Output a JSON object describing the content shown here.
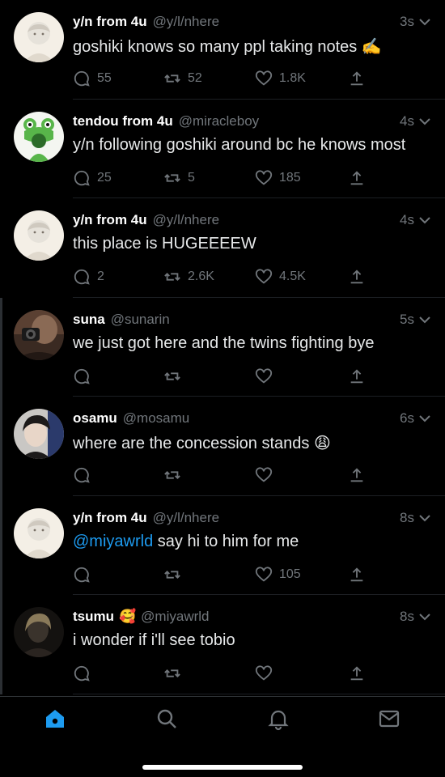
{
  "tweets": [
    {
      "name": "y/n from 4u",
      "emoji": "",
      "handle": "@y/l/nhere",
      "time": "3s",
      "text": "goshiki knows so many ppl taking notes ✍️",
      "mention": "",
      "replies": "55",
      "retweets": "52",
      "likes": "1.8K",
      "avatar": "pale-avatar-icon"
    },
    {
      "name": "tendou from 4u",
      "emoji": "",
      "handle": "@miracleboy",
      "time": "4s",
      "text": "y/n following goshiki around bc he knows most",
      "mention": "",
      "replies": "25",
      "retweets": "5",
      "likes": "185",
      "avatar": "frog-hat-avatar-icon"
    },
    {
      "name": "y/n from 4u",
      "emoji": "",
      "handle": "@y/l/nhere",
      "time": "4s",
      "text": "this place is HUGEEEEW",
      "mention": "",
      "replies": "2",
      "retweets": "2.6K",
      "likes": "4.5K",
      "avatar": "pale-avatar-icon"
    },
    {
      "name": "suna",
      "emoji": "",
      "handle": "@sunarin",
      "time": "5s",
      "text": "we just got here and the twins fighting bye",
      "mention": "",
      "replies": "",
      "retweets": "",
      "likes": "",
      "avatar": "camera-photo-avatar-icon"
    },
    {
      "name": "osamu",
      "emoji": "",
      "handle": "@mosamu",
      "time": "6s",
      "text": "where are the concession stands 😩",
      "mention": "",
      "replies": "",
      "retweets": "",
      "likes": "",
      "avatar": "dark-hair-avatar-icon"
    },
    {
      "name": "y/n from 4u",
      "emoji": "",
      "handle": "@y/l/nhere",
      "time": "8s",
      "text": " say hi to him for me",
      "mention": "@miyawrld",
      "replies": "",
      "retweets": "",
      "likes": "105",
      "avatar": "pale-avatar-icon"
    },
    {
      "name": "tsumu",
      "emoji": "🥰",
      "handle": "@miyawrld",
      "time": "8s",
      "text": "i wonder if i'll see tobio",
      "mention": "",
      "replies": "",
      "retweets": "",
      "likes": "",
      "avatar": "dark-photo-avatar-icon"
    }
  ],
  "nav": {
    "home": "home-icon",
    "search": "search-icon",
    "notifications": "bell-icon",
    "messages": "mail-icon",
    "accent": "#1d9bf0"
  }
}
